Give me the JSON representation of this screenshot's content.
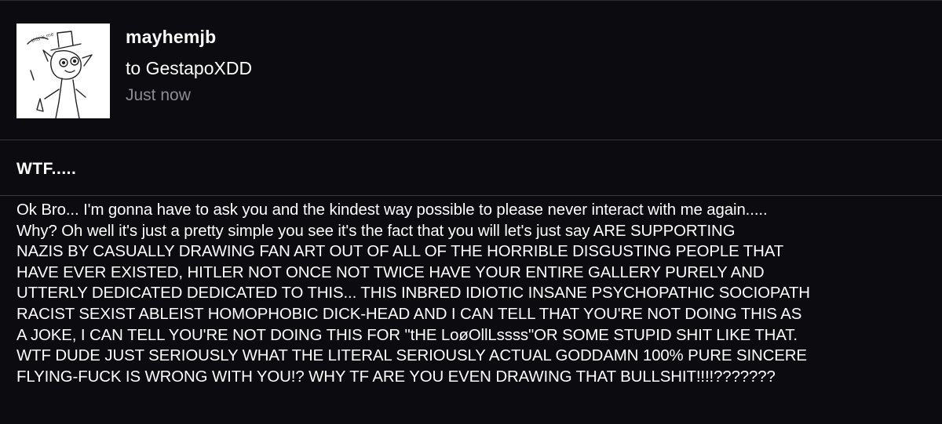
{
  "message": {
    "sender": "mayhemjb",
    "recipient": "to GestapoXDD",
    "timestamp": "Just now",
    "subject": "WTF.....",
    "body": "Ok Bro... I'm gonna have to ask you and the kindest way possible to please never interact with me again.....\nWhy? Oh well it's just a pretty simple you see it's the fact that you will let's just say ARE SUPPORTING\nNAZIS BY CASUALLY DRAWING FAN ART OUT OF ALL OF THE HORRIBLE DISGUSTING PEOPLE THAT\nHAVE EVER EXISTED, HITLER NOT ONCE NOT TWICE HAVE YOUR ENTIRE GALLERY PURELY AND\nUTTERLY DEDICATED DEDICATED TO THIS... THIS INBRED IDIOTIC INSANE PSYCHOPATHIC SOCIOPATH\nRACIST SEXIST ABLEIST HOMOPHOBIC DICK-HEAD AND I CAN TELL THAT YOU'RE NOT DOING THIS AS\nA JOKE, I CAN TELL YOU'RE NOT DOING THIS FOR \"tHE LoøOllLssss\"OR SOME STUPID SHIT LIKE THAT.\nWTF DUDE JUST SERIOUSLY WHAT THE LITERAL SERIOUSLY ACTUAL GODDAMN 100% PURE SINCERE\nFLYING-FUCK IS WRONG WITH YOU!? WHY TF ARE YOU EVEN DRAWING THAT BULLSHIT!!!!???????"
  },
  "avatar": {
    "icon": "sketch-avatar-icon",
    "background": "#ffffff"
  },
  "colors": {
    "background": "#0c0b10",
    "text": "#ffffff",
    "muted": "#8c8c92",
    "divider": "#36363c"
  }
}
